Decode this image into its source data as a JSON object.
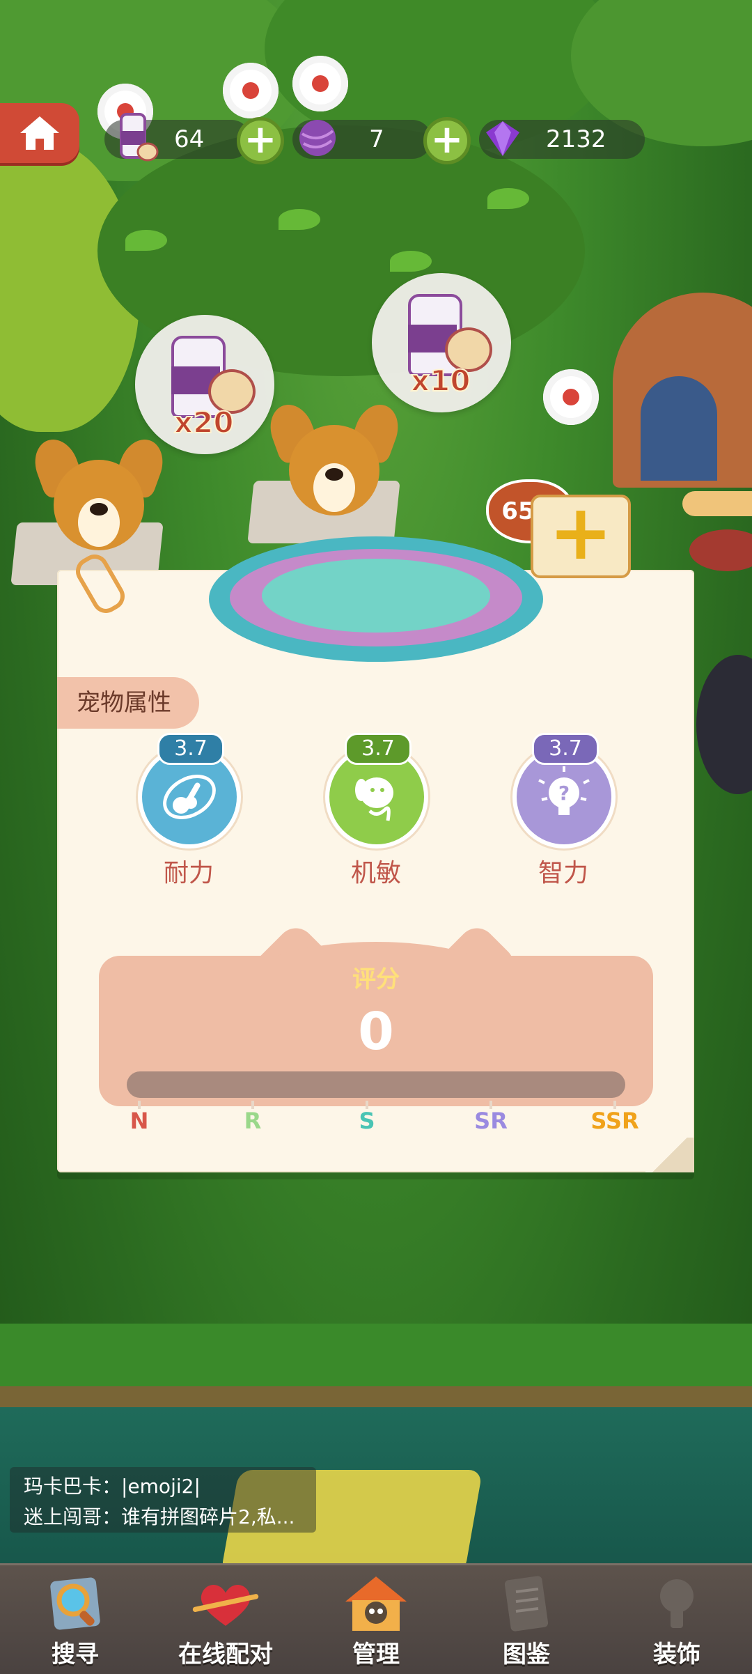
{
  "resources": {
    "milk": {
      "value": "64",
      "icon": "milk-bottle-icon"
    },
    "yarn": {
      "value": "7",
      "icon": "yarn-ball-icon"
    },
    "gems": {
      "value": "2132",
      "icon": "purple-gem-icon"
    }
  },
  "bubbles": [
    {
      "qty": "x20"
    },
    {
      "qty": "x10"
    }
  ],
  "bed": {
    "progress": "65%"
  },
  "card": {
    "section_title": "宠物属性",
    "stats": [
      {
        "name": "耐力",
        "value": "3.7",
        "icon": "endurance-icon",
        "color": "#5ab3d6",
        "tag_color": "#2f7fa6"
      },
      {
        "name": "机敏",
        "value": "3.7",
        "icon": "agility-dog-icon",
        "color": "#8fcc4a",
        "tag_color": "#5d9a2a"
      },
      {
        "name": "智力",
        "value": "3.7",
        "icon": "intelligence-bulb-icon",
        "color": "#a897d8",
        "tag_color": "#7a68b8"
      }
    ],
    "score": {
      "label": "评分",
      "value": "0",
      "progress": 0
    },
    "ranks": [
      {
        "label": "N",
        "color": "#d8574a"
      },
      {
        "label": "R",
        "color": "#9ad88a"
      },
      {
        "label": "S",
        "color": "#4ac4b4"
      },
      {
        "label": "SR",
        "color": "#9a8ae0"
      },
      {
        "label": "SSR",
        "color": "#f0a21a"
      }
    ]
  },
  "chat": {
    "lines": [
      "玛卡巴卡：|emoji2|",
      "迷上闯哥：谁有拼图碎片2,私..."
    ]
  },
  "nav": [
    {
      "label": "搜寻",
      "icon": "magnifier-icon"
    },
    {
      "label": "在线配对",
      "icon": "heart-icon"
    },
    {
      "label": "管理",
      "icon": "house-icon"
    },
    {
      "label": "图鉴",
      "icon": "book-icon"
    },
    {
      "label": "装饰",
      "icon": "decor-icon"
    }
  ]
}
